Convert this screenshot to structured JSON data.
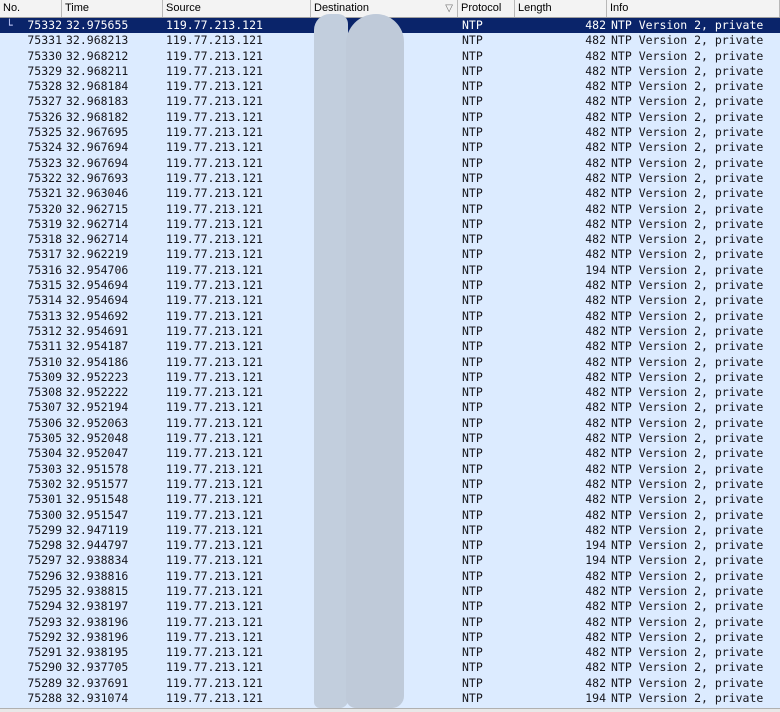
{
  "columns": {
    "no": "No.",
    "time": "Time",
    "source": "Source",
    "destination": "Destination",
    "protocol": "Protocol",
    "length": "Length",
    "info": "Info"
  },
  "icons": {
    "sort_indicator": "sort-down-triangle-icon",
    "tree": "tree-branch-icon"
  },
  "colors": {
    "row_background": "#dcebff",
    "selected_background": "#0a246a",
    "redaction": "#c2cedd"
  },
  "packets": [
    {
      "no": "75332",
      "time": "32.975655",
      "source": "119.77.213.121",
      "destination": "",
      "protocol": "NTP",
      "length": "482",
      "info": "NTP Version 2, private",
      "selected": true
    },
    {
      "no": "75331",
      "time": "32.968213",
      "source": "119.77.213.121",
      "destination": "",
      "protocol": "NTP",
      "length": "482",
      "info": "NTP Version 2, private"
    },
    {
      "no": "75330",
      "time": "32.968212",
      "source": "119.77.213.121",
      "destination": "",
      "protocol": "NTP",
      "length": "482",
      "info": "NTP Version 2, private"
    },
    {
      "no": "75329",
      "time": "32.968211",
      "source": "119.77.213.121",
      "destination": "",
      "protocol": "NTP",
      "length": "482",
      "info": "NTP Version 2, private"
    },
    {
      "no": "75328",
      "time": "32.968184",
      "source": "119.77.213.121",
      "destination": "",
      "protocol": "NTP",
      "length": "482",
      "info": "NTP Version 2, private"
    },
    {
      "no": "75327",
      "time": "32.968183",
      "source": "119.77.213.121",
      "destination": "",
      "protocol": "NTP",
      "length": "482",
      "info": "NTP Version 2, private"
    },
    {
      "no": "75326",
      "time": "32.968182",
      "source": "119.77.213.121",
      "destination": "",
      "protocol": "NTP",
      "length": "482",
      "info": "NTP Version 2, private"
    },
    {
      "no": "75325",
      "time": "32.967695",
      "source": "119.77.213.121",
      "destination": "",
      "protocol": "NTP",
      "length": "482",
      "info": "NTP Version 2, private"
    },
    {
      "no": "75324",
      "time": "32.967694",
      "source": "119.77.213.121",
      "destination": "",
      "protocol": "NTP",
      "length": "482",
      "info": "NTP Version 2, private"
    },
    {
      "no": "75323",
      "time": "32.967694",
      "source": "119.77.213.121",
      "destination": "",
      "protocol": "NTP",
      "length": "482",
      "info": "NTP Version 2, private"
    },
    {
      "no": "75322",
      "time": "32.967693",
      "source": "119.77.213.121",
      "destination": "",
      "protocol": "NTP",
      "length": "482",
      "info": "NTP Version 2, private"
    },
    {
      "no": "75321",
      "time": "32.963046",
      "source": "119.77.213.121",
      "destination": "",
      "protocol": "NTP",
      "length": "482",
      "info": "NTP Version 2, private"
    },
    {
      "no": "75320",
      "time": "32.962715",
      "source": "119.77.213.121",
      "destination": "",
      "protocol": "NTP",
      "length": "482",
      "info": "NTP Version 2, private"
    },
    {
      "no": "75319",
      "time": "32.962714",
      "source": "119.77.213.121",
      "destination": "",
      "protocol": "NTP",
      "length": "482",
      "info": "NTP Version 2, private"
    },
    {
      "no": "75318",
      "time": "32.962714",
      "source": "119.77.213.121",
      "destination": "",
      "protocol": "NTP",
      "length": "482",
      "info": "NTP Version 2, private"
    },
    {
      "no": "75317",
      "time": "32.962219",
      "source": "119.77.213.121",
      "destination": "",
      "protocol": "NTP",
      "length": "482",
      "info": "NTP Version 2, private"
    },
    {
      "no": "75316",
      "time": "32.954706",
      "source": "119.77.213.121",
      "destination": "",
      "protocol": "NTP",
      "length": "194",
      "info": "NTP Version 2, private"
    },
    {
      "no": "75315",
      "time": "32.954694",
      "source": "119.77.213.121",
      "destination": "",
      "protocol": "NTP",
      "length": "482",
      "info": "NTP Version 2, private"
    },
    {
      "no": "75314",
      "time": "32.954694",
      "source": "119.77.213.121",
      "destination": "",
      "protocol": "NTP",
      "length": "482",
      "info": "NTP Version 2, private"
    },
    {
      "no": "75313",
      "time": "32.954692",
      "source": "119.77.213.121",
      "destination": "",
      "protocol": "NTP",
      "length": "482",
      "info": "NTP Version 2, private"
    },
    {
      "no": "75312",
      "time": "32.954691",
      "source": "119.77.213.121",
      "destination": "",
      "protocol": "NTP",
      "length": "482",
      "info": "NTP Version 2, private"
    },
    {
      "no": "75311",
      "time": "32.954187",
      "source": "119.77.213.121",
      "destination": "",
      "protocol": "NTP",
      "length": "482",
      "info": "NTP Version 2, private"
    },
    {
      "no": "75310",
      "time": "32.954186",
      "source": "119.77.213.121",
      "destination": "",
      "protocol": "NTP",
      "length": "482",
      "info": "NTP Version 2, private"
    },
    {
      "no": "75309",
      "time": "32.952223",
      "source": "119.77.213.121",
      "destination": "",
      "protocol": "NTP",
      "length": "482",
      "info": "NTP Version 2, private"
    },
    {
      "no": "75308",
      "time": "32.952222",
      "source": "119.77.213.121",
      "destination": "",
      "protocol": "NTP",
      "length": "482",
      "info": "NTP Version 2, private"
    },
    {
      "no": "75307",
      "time": "32.952194",
      "source": "119.77.213.121",
      "destination": "",
      "protocol": "NTP",
      "length": "482",
      "info": "NTP Version 2, private"
    },
    {
      "no": "75306",
      "time": "32.952063",
      "source": "119.77.213.121",
      "destination": "",
      "protocol": "NTP",
      "length": "482",
      "info": "NTP Version 2, private"
    },
    {
      "no": "75305",
      "time": "32.952048",
      "source": "119.77.213.121",
      "destination": "",
      "protocol": "NTP",
      "length": "482",
      "info": "NTP Version 2, private"
    },
    {
      "no": "75304",
      "time": "32.952047",
      "source": "119.77.213.121",
      "destination": "",
      "protocol": "NTP",
      "length": "482",
      "info": "NTP Version 2, private"
    },
    {
      "no": "75303",
      "time": "32.951578",
      "source": "119.77.213.121",
      "destination": "",
      "protocol": "NTP",
      "length": "482",
      "info": "NTP Version 2, private"
    },
    {
      "no": "75302",
      "time": "32.951577",
      "source": "119.77.213.121",
      "destination": "",
      "protocol": "NTP",
      "length": "482",
      "info": "NTP Version 2, private"
    },
    {
      "no": "75301",
      "time": "32.951548",
      "source": "119.77.213.121",
      "destination": "",
      "protocol": "NTP",
      "length": "482",
      "info": "NTP Version 2, private"
    },
    {
      "no": "75300",
      "time": "32.951547",
      "source": "119.77.213.121",
      "destination": "",
      "protocol": "NTP",
      "length": "482",
      "info": "NTP Version 2, private"
    },
    {
      "no": "75299",
      "time": "32.947119",
      "source": "119.77.213.121",
      "destination": "",
      "protocol": "NTP",
      "length": "482",
      "info": "NTP Version 2, private"
    },
    {
      "no": "75298",
      "time": "32.944797",
      "source": "119.77.213.121",
      "destination": "",
      "protocol": "NTP",
      "length": "194",
      "info": "NTP Version 2, private"
    },
    {
      "no": "75297",
      "time": "32.938834",
      "source": "119.77.213.121",
      "destination": "",
      "protocol": "NTP",
      "length": "194",
      "info": "NTP Version 2, private"
    },
    {
      "no": "75296",
      "time": "32.938816",
      "source": "119.77.213.121",
      "destination": "",
      "protocol": "NTP",
      "length": "482",
      "info": "NTP Version 2, private"
    },
    {
      "no": "75295",
      "time": "32.938815",
      "source": "119.77.213.121",
      "destination": "",
      "protocol": "NTP",
      "length": "482",
      "info": "NTP Version 2, private"
    },
    {
      "no": "75294",
      "time": "32.938197",
      "source": "119.77.213.121",
      "destination": "",
      "protocol": "NTP",
      "length": "482",
      "info": "NTP Version 2, private"
    },
    {
      "no": "75293",
      "time": "32.938196",
      "source": "119.77.213.121",
      "destination": "",
      "protocol": "NTP",
      "length": "482",
      "info": "NTP Version 2, private"
    },
    {
      "no": "75292",
      "time": "32.938196",
      "source": "119.77.213.121",
      "destination": "",
      "protocol": "NTP",
      "length": "482",
      "info": "NTP Version 2, private"
    },
    {
      "no": "75291",
      "time": "32.938195",
      "source": "119.77.213.121",
      "destination": "",
      "protocol": "NTP",
      "length": "482",
      "info": "NTP Version 2, private"
    },
    {
      "no": "75290",
      "time": "32.937705",
      "source": "119.77.213.121",
      "destination": "",
      "protocol": "NTP",
      "length": "482",
      "info": "NTP Version 2, private"
    },
    {
      "no": "75289",
      "time": "32.937691",
      "source": "119.77.213.121",
      "destination": "",
      "protocol": "NTP",
      "length": "482",
      "info": "NTP Version 2, private"
    },
    {
      "no": "75288",
      "time": "32.931074",
      "source": "119.77.213.121",
      "destination": "",
      "protocol": "NTP",
      "length": "194",
      "info": "NTP Version 2, private"
    }
  ]
}
